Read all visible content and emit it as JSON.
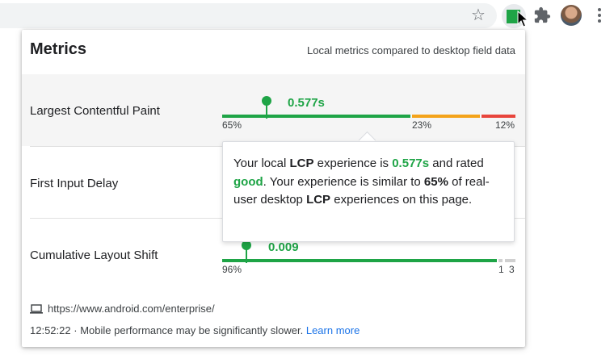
{
  "toolbar": {
    "star_icon": "star-outline-icon",
    "extension_icon": "green-square-extension-icon",
    "puzzle_icon": "puzzle-icon",
    "menu_icon": "kebab-menu-icon",
    "accent_color": "#1ea446"
  },
  "popup": {
    "title": "Metrics",
    "subtitle": "Local metrics compared to desktop field data",
    "metrics": [
      {
        "label": "Largest Contentful Paint",
        "value": "0.577s",
        "good_pct": "65%",
        "ni_pct": "23%",
        "poor_pct": "12%",
        "good_fraction": 0.65,
        "ni_fraction": 0.23,
        "poor_fraction": 0.12,
        "marker_fraction": 0.2
      },
      {
        "label": "First Input Delay"
      },
      {
        "label": "Cumulative Layout Shift",
        "value": "0.009",
        "good_pct": "96%",
        "ni_pct": "1",
        "poor_pct": "3",
        "good_fraction": 0.96,
        "ni_fraction": 0.01,
        "poor_fraction": 0.03,
        "marker_fraction": 0.11
      }
    ],
    "tooltip": {
      "t1": "Your local ",
      "t2": "LCP",
      "t3": " experience is ",
      "t4": "0.577s",
      "t5": " and rated ",
      "t6": "good",
      "t7": ". Your experience is similar to ",
      "t8": "65%",
      "t9": " of real-user desktop ",
      "t10": "LCP",
      "t11": " experiences on this page."
    },
    "url": "https://www.android.com/enterprise/",
    "footer": {
      "time": "12:52:22",
      "separator": "·",
      "note": "Mobile performance may be significantly slower.",
      "link": "Learn more"
    }
  }
}
